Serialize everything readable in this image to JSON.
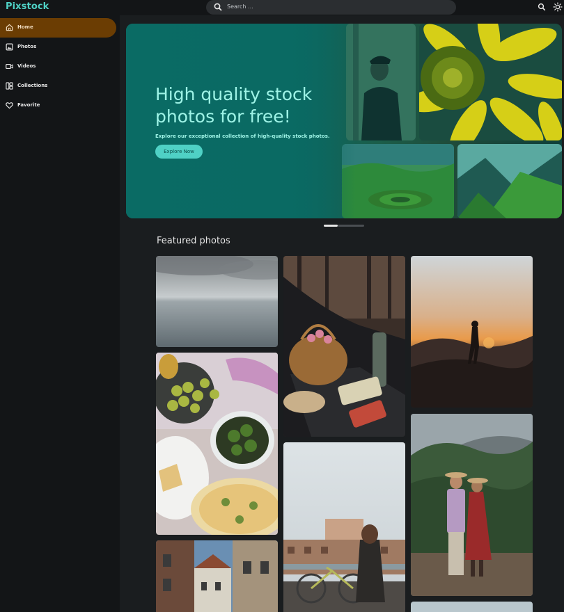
{
  "app": {
    "name": "Pixstock"
  },
  "search": {
    "placeholder": "Search ..."
  },
  "header_icons": [
    "search-icon",
    "theme-toggle-icon"
  ],
  "sidebar": {
    "items": [
      {
        "label": "Home",
        "icon": "home-icon",
        "active": true
      },
      {
        "label": "Photos",
        "icon": "photos-icon",
        "active": false
      },
      {
        "label": "Videos",
        "icon": "videos-icon",
        "active": false
      },
      {
        "label": "Collections",
        "icon": "collections-icon",
        "active": false
      },
      {
        "label": "Favorite",
        "icon": "heart-icon",
        "active": false
      }
    ]
  },
  "hero": {
    "title": "High quality stock photos for free!",
    "subtitle": "Explore our exceptional collection of high-quality stock photos.",
    "button_label": "Explore Now",
    "slide_index": 1,
    "slide_count": 3
  },
  "featured": {
    "title": "Featured photos",
    "photos": [
      {
        "subject": "calm sea under grey sky"
      },
      {
        "subject": "picnic basket with tulips in car trunk"
      },
      {
        "subject": "hiker on mountain at sunset"
      },
      {
        "subject": "table with grapes, salad and tarts"
      },
      {
        "subject": "woman with bicycle by river"
      },
      {
        "subject": "couple in hats standing in field"
      },
      {
        "subject": "narrow street with buildings"
      }
    ]
  },
  "colors": {
    "accent": "#4fd1c5",
    "active_nav": "#6b3d03",
    "background": "#131517",
    "hero": "#0a6a63"
  }
}
